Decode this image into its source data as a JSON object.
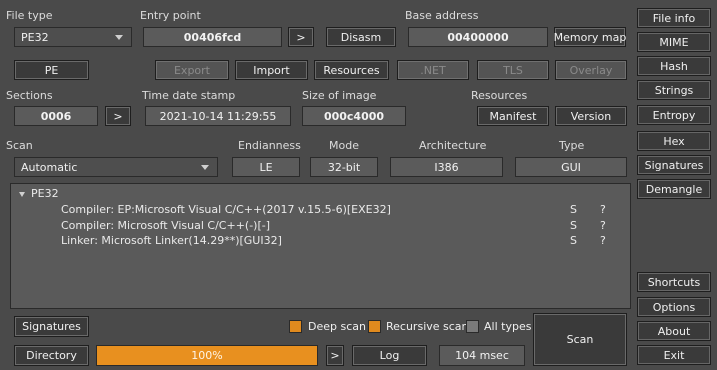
{
  "file_type": {
    "label": "File type",
    "value": "PE32"
  },
  "entry_point": {
    "label": "Entry point",
    "value": "00406fcd",
    "go": ">",
    "disasm": "Disasm"
  },
  "base_address": {
    "label": "Base address",
    "value": "00400000",
    "memory_map": "Memory map"
  },
  "row2": {
    "pe": "PE",
    "export": "Export",
    "import": "Import",
    "resources": "Resources",
    "net": ".NET",
    "tls": "TLS",
    "overlay": "Overlay"
  },
  "sections": {
    "label": "Sections",
    "value": "0006",
    "go": ">"
  },
  "time_date_stamp": {
    "label": "Time date stamp",
    "value": "2021-10-14 11:29:55"
  },
  "size_of_image": {
    "label": "Size of image",
    "value": "000c4000"
  },
  "resources": {
    "label": "Resources",
    "manifest": "Manifest",
    "version": "Version"
  },
  "scan_row": {
    "scan_label": "Scan",
    "scan_value": "Automatic",
    "endianness_label": "Endianness",
    "endianness_value": "LE",
    "mode_label": "Mode",
    "mode_value": "32-bit",
    "arch_label": "Architecture",
    "arch_value": "I386",
    "type_label": "Type",
    "type_value": "GUI"
  },
  "results": {
    "root": "PE32",
    "items": [
      {
        "text": "Compiler: EP:Microsoft Visual C/C++(2017 v.15.5-6)[EXE32]",
        "s": "S",
        "q": "?"
      },
      {
        "text": "Compiler: Microsoft Visual C/C++(-)[-]",
        "s": "S",
        "q": "?"
      },
      {
        "text": "Linker: Microsoft Linker(14.29**)[GUI32]",
        "s": "S",
        "q": "?"
      }
    ]
  },
  "sidebar": {
    "file_info": "File info",
    "mime": "MIME",
    "hash": "Hash",
    "strings": "Strings",
    "entropy": "Entropy",
    "hex": "Hex",
    "signatures": "Signatures",
    "demangle": "Demangle",
    "shortcuts": "Shortcuts",
    "options": "Options",
    "about": "About",
    "exit": "Exit"
  },
  "bottom": {
    "signatures": "Signatures",
    "deep_scan": "Deep scan",
    "recursive_scan": "Recursive scan",
    "all_types": "All types",
    "scan": "Scan",
    "directory": "Directory",
    "progress": "100%",
    "progress_value": 100,
    "go": ">",
    "log": "Log",
    "time": "104 msec"
  },
  "colors": {
    "accent": "#e8901f",
    "background": "#4a4a4a"
  }
}
